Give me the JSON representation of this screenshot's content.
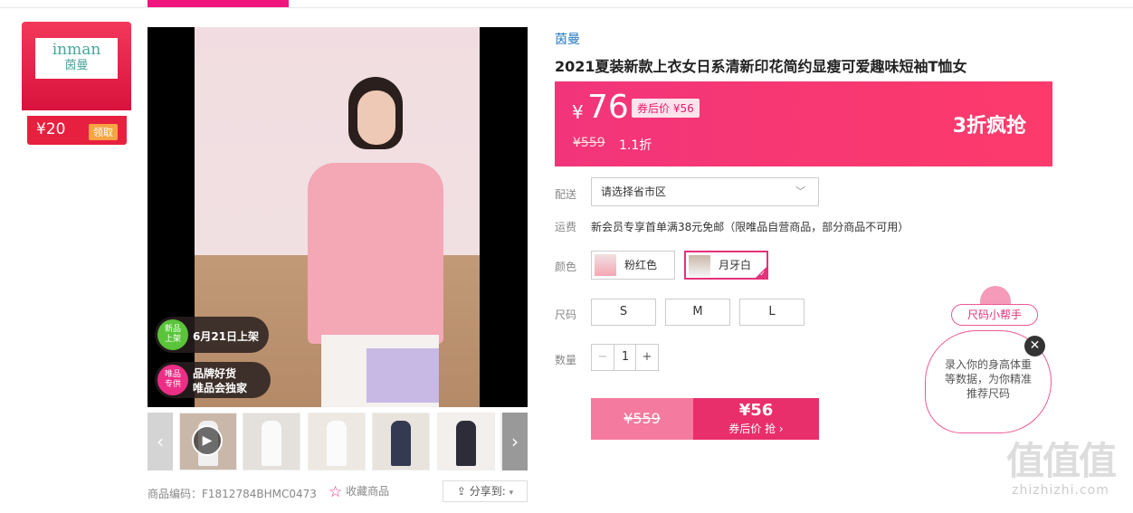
{
  "coupon": {
    "logo_en": "inman",
    "logo_cn": "茵曼",
    "amount": "¥20",
    "claim_label": "领取"
  },
  "gallery": {
    "badge_new_icon": "新品\n上架",
    "badge_new_text": "6月21日上架",
    "badge_vip_icon": "唯品\n专供",
    "badge_vip_line1": "品牌好货",
    "badge_vip_line2": "唯品会独家",
    "prev_icon": "‹",
    "next_icon": "›",
    "play_icon": "▶"
  },
  "meta": {
    "code": "商品编码：F1812784BHMC0473",
    "favorite": "收藏商品",
    "share": "分享到:"
  },
  "product": {
    "brand": "茵曼",
    "title": "2021夏装新款上衣女日系清新印花简约显瘦可爱趣味短袖T恤女",
    "currency": "¥",
    "price": "76",
    "after_coupon": "券后价 ¥56",
    "original": "¥559",
    "discount": "1.1折",
    "promo": "3折疯抢"
  },
  "shipping": {
    "label": "配送",
    "placeholder": "请选择省市区"
  },
  "fee": {
    "label": "运费",
    "text": "新会员专享首单满38元免邮（限唯品自营商品，部分商品不可用）"
  },
  "color": {
    "label": "颜色",
    "options": [
      "粉红色",
      "月牙白"
    ],
    "selected": "月牙白"
  },
  "size": {
    "label": "尺码",
    "options": [
      "S",
      "M",
      "L"
    ]
  },
  "quantity": {
    "label": "数量",
    "value": "1",
    "minus": "−",
    "plus": "+"
  },
  "buy": {
    "original": "¥559",
    "price": "¥56",
    "action": "券后价 抢 ›"
  },
  "helper": {
    "tag": "尺码小帮手",
    "bubble": "录入你的身高体重等数据，为你精准推荐尺码",
    "close": "✕"
  },
  "watermark": {
    "big": "值值值",
    "small": "zhizhizhi.com"
  },
  "colors": {
    "accent": "#e4317a",
    "brand_link": "#2478c3",
    "price_bg": "#f2357b"
  }
}
